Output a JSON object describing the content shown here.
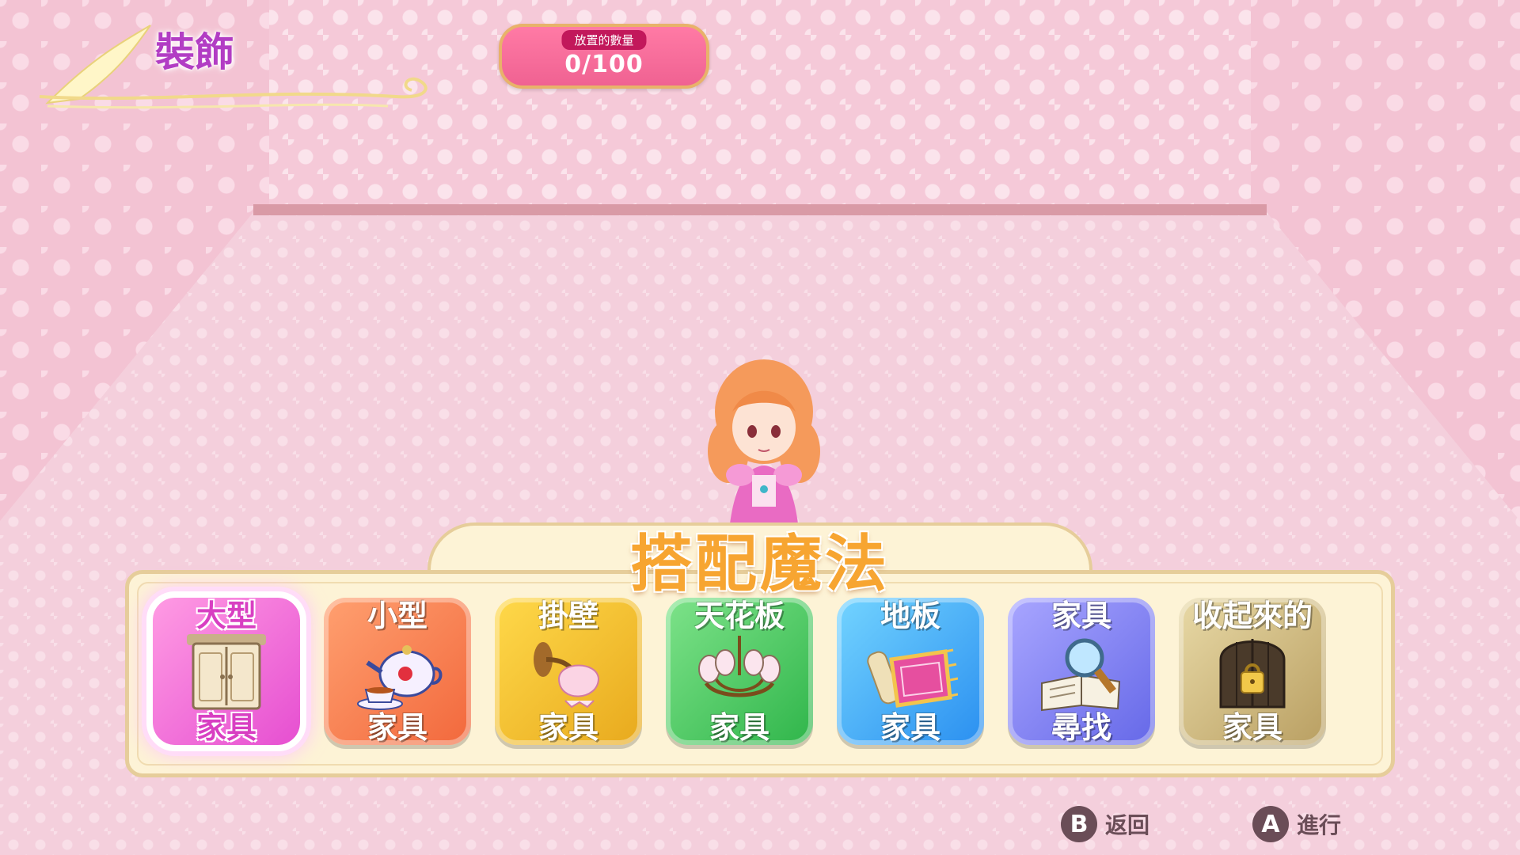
{
  "header": {
    "mode_title": "裝飾"
  },
  "placed_count": {
    "label": "放置的數量",
    "value": "0/100"
  },
  "menu": {
    "title": "搭配魔法",
    "items": [
      {
        "top": "大型",
        "bottom": "家具",
        "icon": "wardrobe-icon",
        "color": "#e64fd1",
        "selected": true
      },
      {
        "top": "小型",
        "bottom": "家具",
        "icon": "teapot-icon",
        "color": "#f2683c",
        "selected": false
      },
      {
        "top": "掛壁",
        "bottom": "家具",
        "icon": "wall-lamp-icon",
        "color": "#e8a91d",
        "selected": false
      },
      {
        "top": "天花板",
        "bottom": "家具",
        "icon": "chandelier-icon",
        "color": "#2fb54a",
        "selected": false
      },
      {
        "top": "地板",
        "bottom": "家具",
        "icon": "rug-icon",
        "color": "#2a8ff0",
        "selected": false
      },
      {
        "top": "家具",
        "bottom": "尋找",
        "icon": "magnifier-book-icon",
        "color": "#6568e8",
        "selected": false
      },
      {
        "top": "收起來的",
        "bottom": "家具",
        "icon": "storage-chest-icon",
        "color": "#b99f62",
        "selected": false
      }
    ]
  },
  "hints": {
    "back": {
      "button": "B",
      "label": "返回"
    },
    "confirm": {
      "button": "A",
      "label": "進行"
    }
  }
}
